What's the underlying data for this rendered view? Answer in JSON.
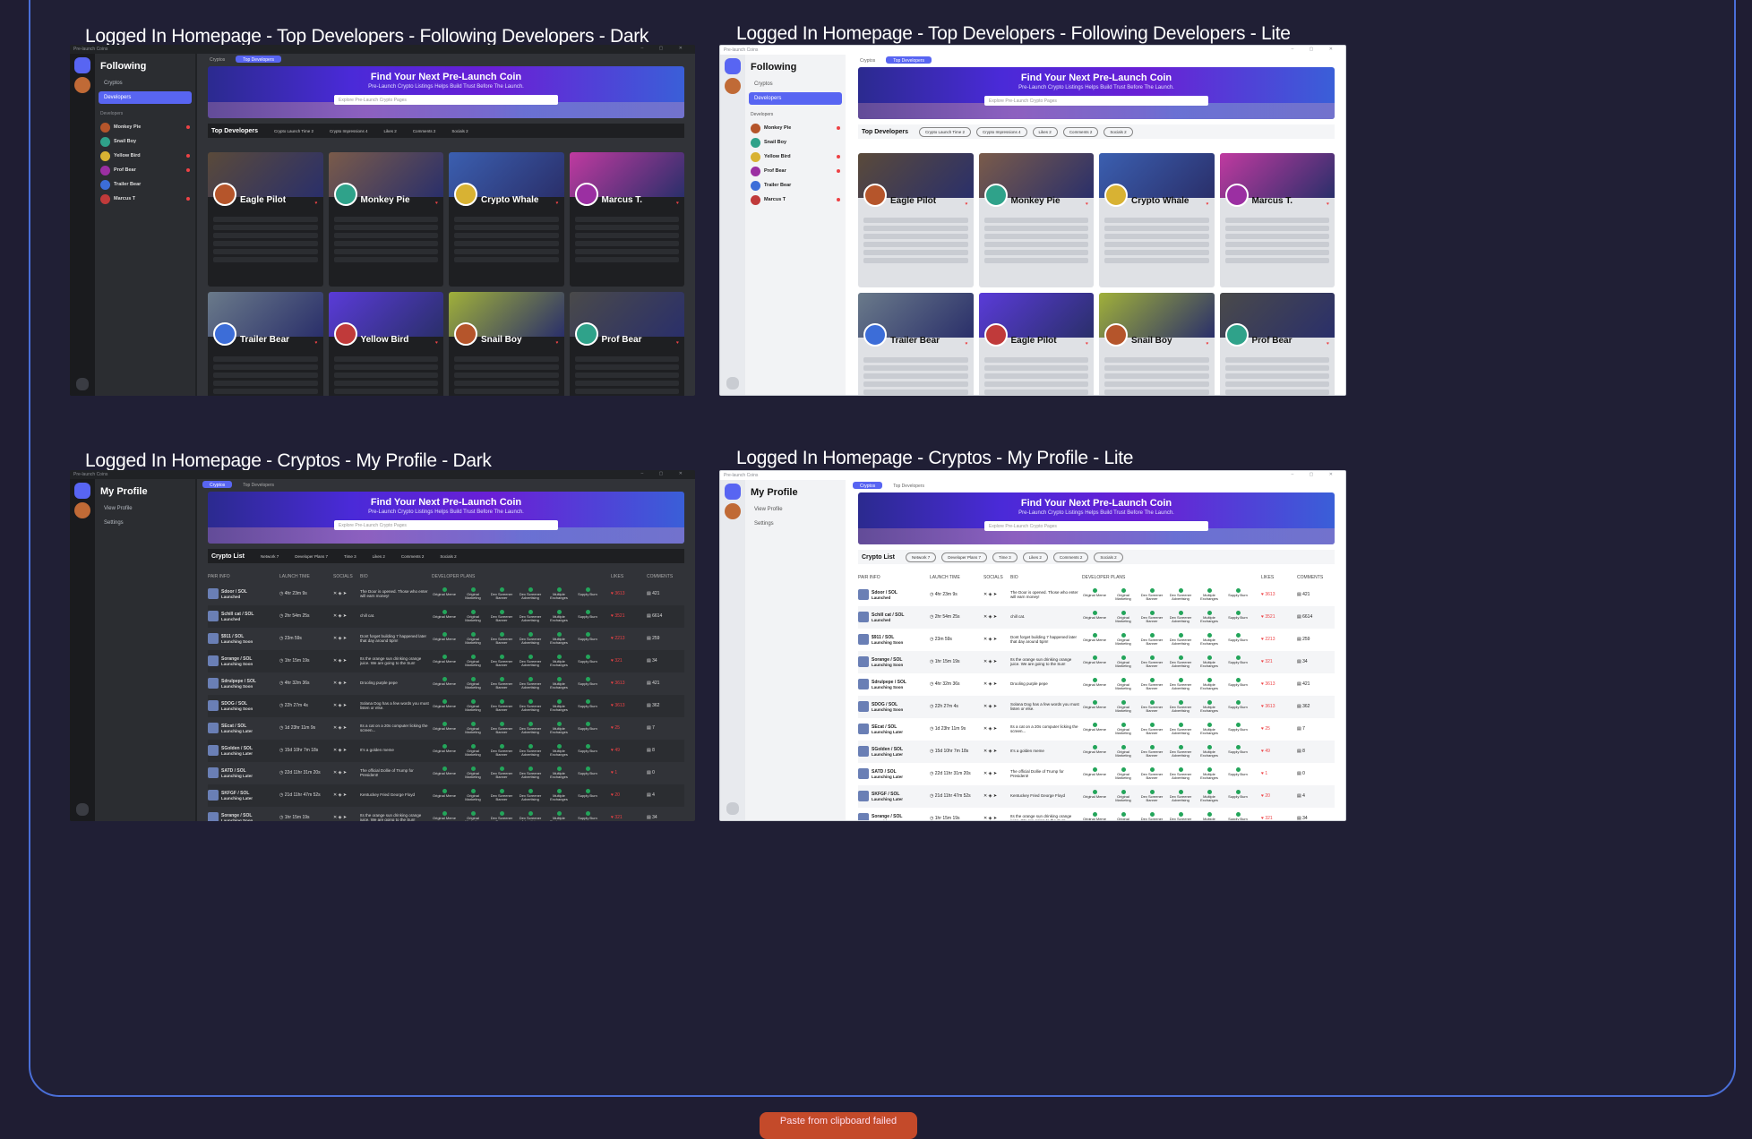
{
  "titles": {
    "tl": "Logged In Homepage - Top Developers - Following Developers - Dark",
    "tr": "Logged In Homepage - Top Developers - Following Developers - Lite",
    "bl": "Logged In Homepage - Cryptos - My Profile - Dark",
    "br": "Logged In Homepage - Cryptos - My Profile - Lite"
  },
  "app": {
    "window_title": "Pre-launch Coins",
    "tabs": [
      "Cryptos",
      "Top Developers"
    ],
    "hero_title": "Find Your Next Pre-Launch Coin",
    "hero_subtitle": "Pre-Launch Crypto Listings Helps Build Trust Before The Launch.",
    "search_placeholder": "Explore Pre-Launch Crypto Pages"
  },
  "following": {
    "heading": "Following",
    "nav": [
      "Cryptos",
      "Developers"
    ],
    "developers_label": "Developers",
    "developers": [
      "Monkey Pie",
      "Snail Boy",
      "Yellow Bird",
      "Prof Bear",
      "Trailer Bear",
      "Marcus T"
    ]
  },
  "top_devs": {
    "title": "Top Developers",
    "filters": [
      "Crypto Launch Time 2",
      "Crypto Impressions 4",
      "Likes 2",
      "Comments 2",
      "Socials 2"
    ],
    "cards_dark": [
      "Eagle Pilot",
      "Monkey Pie",
      "Crypto Whale",
      "Marcus T.",
      "Trailer Bear",
      "Yellow Bird",
      "Snail Boy",
      "Prof Bear"
    ],
    "cards_lite": [
      "Eagle Pilot",
      "Monkey Pie",
      "Crypto Whale",
      "Marcus T.",
      "Trailer Bear",
      "Eagle Pilot",
      "Snail Boy",
      "Prof Bear"
    ]
  },
  "profile": {
    "heading": "My Profile",
    "nav": [
      "View Profile",
      "Settings"
    ]
  },
  "crypto_list": {
    "title": "Crypto List",
    "filters": [
      "Network 7",
      "Developer Plans 7",
      "Time 3",
      "Likes 2",
      "Comments 2",
      "Socials 2"
    ],
    "headers": [
      "PAIR INFO",
      "LAUNCH TIME",
      "SOCIALS",
      "BIO",
      "DEVELOPER PLANS",
      "LIKES",
      "COMMENTS"
    ],
    "rows": [
      {
        "pair": "Sdoor / SOL",
        "status": "Launched",
        "time": "4hr 23m 9s",
        "bio": "The Door is opened. Those who enter will earn money!",
        "likes": "3613",
        "comments": "421"
      },
      {
        "pair": "Schill cat / SOL",
        "status": "Launched",
        "time": "2hr 54m 25s",
        "bio": "chill cat.",
        "likes": "3521",
        "comments": "6614"
      },
      {
        "pair": "$911 / SOL",
        "status": "Launching Soon",
        "time": "23m 59s",
        "bio": "Dont forget building 7 happened later that day around 5pm!",
        "likes": "2213",
        "comments": "259"
      },
      {
        "pair": "Sorange / SOL",
        "status": "Launching Soon",
        "time": "1hr 15m 19s",
        "bio": "Its the orange sun drinking orange juice. We are going to the Sun!",
        "likes": "321",
        "comments": "34"
      },
      {
        "pair": "Sdrulpepe / SOL",
        "status": "Launching Soon",
        "time": "4hr 32m 36s",
        "bio": "Drooling purple pepe",
        "likes": "3613",
        "comments": "421"
      },
      {
        "pair": "SDOG / SOL",
        "status": "Launching Soon",
        "time": "22h 27m 4s",
        "bio": "Solana Dog has a few words you must listen or else.",
        "likes": "3613",
        "comments": "362"
      },
      {
        "pair": "SEcat / SOL",
        "status": "Launching Later",
        "time": "1d 23hr 11m 9s",
        "bio": "Its a cat on a 20s computer licking the screen...",
        "likes": "25",
        "comments": "7"
      },
      {
        "pair": "SGolden / SOL",
        "status": "Launching Later",
        "time": "15d 10hr 7m 18s",
        "bio": "It's a golden meme",
        "likes": "49",
        "comments": "8"
      },
      {
        "pair": "SATD / SOL",
        "status": "Launching Later",
        "time": "22d 11hr 31m 20s",
        "bio": "The official Dollie of Trump for President!",
        "likes": "1",
        "comments": "0"
      },
      {
        "pair": "SKFGF / SOL",
        "status": "Launching Later",
        "time": "21d 11hr 47m 52s",
        "bio": "Kentuckey Fried George Floyd",
        "likes": "20",
        "comments": "4"
      },
      {
        "pair": "Sorange / SOL",
        "status": "Launching Soon",
        "time": "1hr 15m 19s",
        "bio": "Its the orange sun drinking orange juice. We are going to the Sun!",
        "likes": "321",
        "comments": "34"
      }
    ],
    "plans": [
      "Original Meme",
      "Original Marketing",
      "Dex Screener Banner",
      "Dex Screener Advertising",
      "Multiple Exchanges",
      "Supply Burn"
    ]
  },
  "toast": "Paste from clipboard failed",
  "colors": {
    "accent": "#5865f2",
    "like": "#ed4245",
    "ok": "#23a55a",
    "board_border": "#4a6fd8"
  }
}
